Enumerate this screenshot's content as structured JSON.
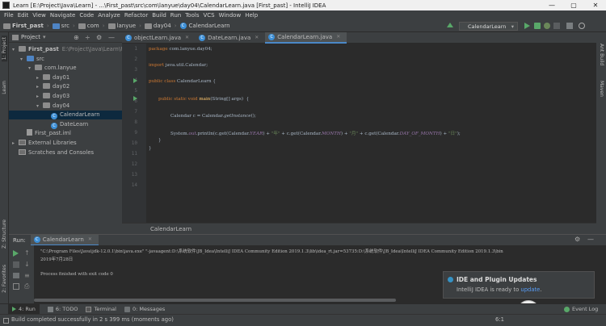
{
  "window": {
    "title": "Learn [E:\\Project\\Java\\Learn] - ...\\First_past\\src\\com\\lanyue\\day04\\CalendarLearn.java [First_past] - IntelliJ IDEA",
    "minimize": "—",
    "maximize": "▢",
    "close": "✕"
  },
  "menu": [
    "File",
    "Edit",
    "View",
    "Navigate",
    "Code",
    "Analyze",
    "Refactor",
    "Build",
    "Run",
    "Tools",
    "VCS",
    "Window",
    "Help"
  ],
  "breadcrumbs": [
    "First_past",
    "src",
    "com",
    "lanyue",
    "day04",
    "CalendarLearn"
  ],
  "run_config": "CalendarLearn",
  "left_strip": {
    "project": "1: Project",
    "learn": "Learn",
    "structure": "Z: Structure",
    "favorites": "2: Favorites"
  },
  "right_strip": {
    "ant": "Ant Build",
    "maven": "Maven"
  },
  "project_panel": {
    "title": "Project",
    "tree": [
      {
        "label": "First_past",
        "hint": "E:\\Project\\Java\\Learn\\Firs",
        "icon": "folder-icon",
        "depth": 0,
        "arrow": "▾"
      },
      {
        "label": "src",
        "icon": "source-folder-icon",
        "depth": 1,
        "arrow": "▾"
      },
      {
        "label": "com.lanyue",
        "icon": "package-icon",
        "depth": 2,
        "arrow": "▾"
      },
      {
        "label": "day01",
        "icon": "package-icon",
        "depth": 3,
        "arrow": "▸"
      },
      {
        "label": "day02",
        "icon": "package-icon",
        "depth": 3,
        "arrow": "▸"
      },
      {
        "label": "day03",
        "icon": "package-icon",
        "depth": 3,
        "arrow": "▸"
      },
      {
        "label": "day04",
        "icon": "package-icon",
        "depth": 3,
        "arrow": "▾"
      },
      {
        "label": "CalendarLearn",
        "icon": "class-icon",
        "depth": 4,
        "arrow": "",
        "selected": true
      },
      {
        "label": "DateLearn",
        "icon": "class-icon",
        "depth": 4,
        "arrow": ""
      },
      {
        "label": "First_past.iml",
        "icon": "iml-file-icon",
        "depth": 1,
        "arrow": ""
      },
      {
        "label": "External Libraries",
        "icon": "library-icon",
        "depth": 0,
        "arrow": "▸"
      },
      {
        "label": "Scratches and Consoles",
        "icon": "scratches-icon",
        "depth": 0,
        "arrow": ""
      }
    ]
  },
  "editor_tabs": [
    {
      "label": "objectLearn.java",
      "active": false
    },
    {
      "label": "DateLearn.java",
      "active": false
    },
    {
      "label": "CalendarLearn.java",
      "active": true
    }
  ],
  "code": {
    "line_numbers": [
      "1",
      "2",
      "3",
      "4",
      "5",
      "6",
      "7",
      "8",
      "9",
      "10",
      "11",
      "12",
      "13",
      "14"
    ],
    "line1_kw": "package",
    "line1_rest": " com.lanyue.day04;",
    "line3_kw": "import",
    "line3_rest": " java.util.Calendar;",
    "line5_kw": "public class",
    "line5_rest": " CalendarLearn {",
    "line8_kw": "public static void",
    "line8_fn": " main",
    "line8_rest": "(String[] args)  {",
    "line10": "Calendar c = Calendar.",
    "line10_m": "getInstance",
    "line10_end": "();",
    "line12_a": "System.",
    "line12_out": "out",
    "line12_b": ".println(c.get(Calendar.",
    "line12_year": "YEAR",
    "line12_c": ") + ",
    "line12_s1": "\"年\"",
    "line12_d": " + c.get(Calendar.",
    "line12_month": "MONTH",
    "line12_e": ") + ",
    "line12_s2": "\"月\"",
    "line12_f": " + c.get(Calendar.",
    "line12_dom": "DAY_OF_MONTH",
    "line12_g": ") + ",
    "line12_s3": "\"日\"",
    "line12_h": ");",
    "line13": "}",
    "line14": "}"
  },
  "editor_breadcrumb": "CalendarLearn",
  "run_panel": {
    "label": "Run:",
    "tab": "CalendarLearn",
    "console": [
      "\"C:\\Program Files\\Java\\jdk-12.0.1\\bin\\java.exe\" \"-javaagent:D:\\系统软件\\JB_Idea\\IntelliJ IDEA Community Edition 2019.1.3\\lib\\idea_rt.jar=53735:D:\\系统软件\\JB_Idea\\IntelliJ IDEA Community Edition 2019.1.3\\bin",
      "2019年7月28日",
      "",
      "Process finished with exit code 0"
    ]
  },
  "notification": {
    "title": "IDE and Plugin Updates",
    "body_prefix": "IntelliJ IDEA is ready to ",
    "link": "update",
    "body_suffix": "."
  },
  "bottom_tools": [
    "4: Run",
    "6: TODO",
    "Terminal",
    "0: Messages"
  ],
  "event_log": "Event Log",
  "status": {
    "message": "Build completed successfully in 2 s 399 ms (moments ago)",
    "position": "6:1"
  },
  "colors": {
    "accent": "#4a88c7",
    "run_green": "#59a869",
    "bg": "#2b2b2b",
    "panel": "#3c3f41"
  }
}
